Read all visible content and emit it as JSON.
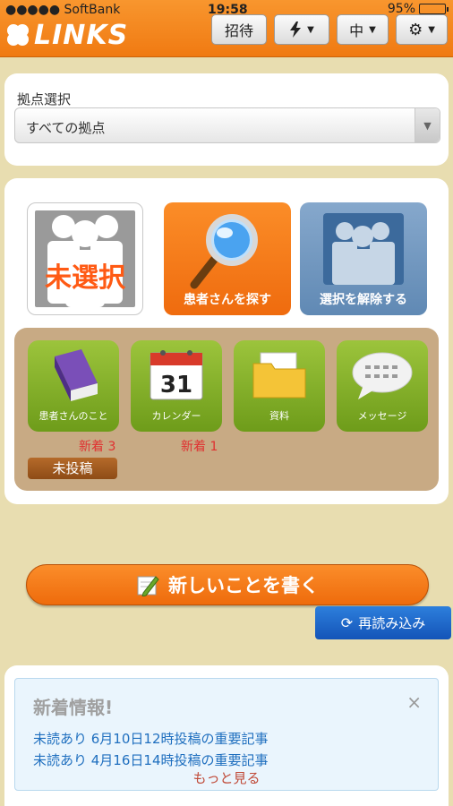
{
  "status_bar": {
    "carrier": "●●●●● SoftBank",
    "time": "19:58",
    "battery": "95%",
    "battery_level": 0.95
  },
  "header": {
    "logo_text": "LINKS",
    "invite_label": "招待",
    "font_size_label": "中"
  },
  "location": {
    "label": "拠点選択",
    "selected": "すべての拠点"
  },
  "patient": {
    "unselected_label": "未選択",
    "search_label": "患者さんを探す",
    "release_label": "選択を解除する"
  },
  "apps": [
    {
      "label": "患者さんのこと",
      "badge": "新着 3",
      "icon": "book-icon"
    },
    {
      "label": "カレンダー",
      "badge": "新着 1",
      "icon": "calendar-icon",
      "calendar_day": "31"
    },
    {
      "label": "資料",
      "badge": "",
      "icon": "folder-icon"
    },
    {
      "label": "メッセージ",
      "badge": "",
      "icon": "speech-bubble-icon"
    }
  ],
  "unposted_label": "未投稿",
  "write_button_label": "新しいことを書く",
  "reload_button_label": "再読み込み",
  "news": {
    "title": "新着情報!",
    "items": [
      "未読あり 6月10日12時投稿の重要記事",
      "未読あり 4月16日14時投稿の重要記事"
    ],
    "more_label": "もっと見る",
    "close_glyph": "×"
  },
  "colors": {
    "header_orange": "#f07a12",
    "app_green": "#7aa823",
    "tray_brown": "#c8aa84",
    "badge_red": "#e03030",
    "reload_blue": "#1a5fc4"
  }
}
